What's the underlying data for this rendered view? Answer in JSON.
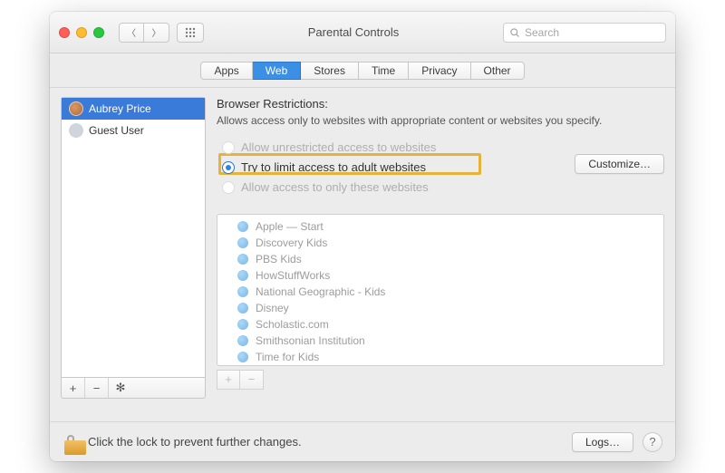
{
  "window": {
    "title": "Parental Controls"
  },
  "toolbar": {
    "search_placeholder": "Search"
  },
  "tabs": {
    "items": [
      "Apps",
      "Web",
      "Stores",
      "Time",
      "Privacy",
      "Other"
    ],
    "selected_index": 1
  },
  "sidebar": {
    "users": [
      {
        "name": "Aubrey Price",
        "selected": true
      },
      {
        "name": "Guest User",
        "selected": false
      }
    ],
    "add_label": "+",
    "remove_label": "−",
    "settings_label": "✻"
  },
  "main": {
    "section_title": "Browser Restrictions:",
    "description": "Allows access only to websites with appropriate content or websites you specify.",
    "radios": {
      "unrestricted": "Allow unrestricted access to websites",
      "limit_adult": "Try to limit access to adult websites",
      "only_these": "Allow access to only these websites"
    },
    "selected_radio": "limit_adult",
    "customize_label": "Customize…",
    "sites": [
      "Apple — Start",
      "Discovery Kids",
      "PBS Kids",
      "HowStuffWorks",
      "National Geographic - Kids",
      "Disney",
      "Scholastic.com",
      "Smithsonian Institution",
      "Time for Kids"
    ],
    "site_add": "+",
    "site_remove": "−"
  },
  "footer": {
    "lock_text": "Click the lock to prevent further changes.",
    "logs_label": "Logs…",
    "help_label": "?"
  }
}
